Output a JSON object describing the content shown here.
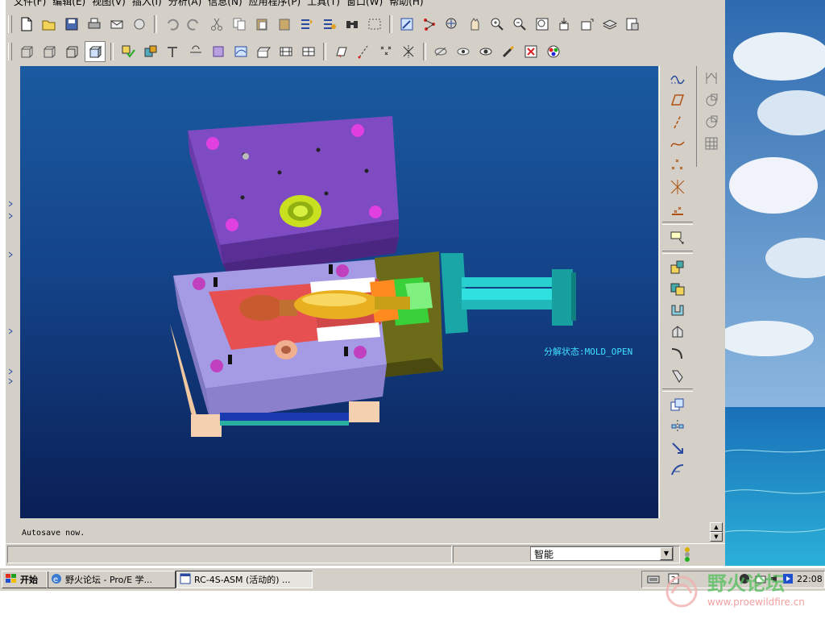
{
  "menu": [
    "文件(F)",
    "编辑(E)",
    "视图(V)",
    "插入(I)",
    "分析(A)",
    "信息(N)",
    "应用程序(P)",
    "工具(T)",
    "窗口(W)",
    "帮助(H)"
  ],
  "viewport": {
    "annotation": "分解状态:MOLD_OPEN"
  },
  "message": {
    "text": "Autosave now."
  },
  "status": {
    "filter_value": "智能"
  },
  "taskbar": {
    "start_label": "开始",
    "items": [
      {
        "label": "野火论坛 - Pro/E 学..."
      },
      {
        "label": "RC-4S-ASM (活动的) ..."
      }
    ],
    "clock": "22:08"
  },
  "watermark": {
    "name": "野火论坛",
    "url": "www.proewildfire.cn"
  },
  "colors": {
    "viewport_top": "#1a5aa0",
    "viewport_bottom": "#0a1f55",
    "window_face": "#d4d0c8",
    "desktop_sky": "#5a93c8",
    "desktop_sea": "#1e88c2"
  },
  "icons": {
    "toolbar1": [
      "new-file-icon",
      "open-folder-icon",
      "save-icon",
      "print-icon",
      "send-mail-icon",
      "mail-icon",
      "undo-icon",
      "redo-icon",
      "cut-icon",
      "copy-icon",
      "paste-icon",
      "paste-special-icon",
      "regenerate-icon",
      "regen-manager-icon",
      "find-icon",
      "select-box-icon",
      "sketch-icon",
      "relations-icon",
      "model-tree-icon",
      "spin-icon",
      "zoom-in-icon",
      "zoom-out-icon",
      "refit-icon",
      "orient-icon",
      "saved-views-icon",
      "layers-icon",
      "view-manager-icon"
    ],
    "toolbar2": [
      "wireframe-icon",
      "hidden-line-icon",
      "no-hidden-icon",
      "shading-icon",
      "mold-layout-icon",
      "mold-component-icon",
      "ejector-pin-icon",
      "waterline-icon",
      "parting-surface-icon",
      "skirt-surface-icon",
      "runner-icon",
      "volume-split-icon",
      "dimension-icon",
      "datum-plane-icon",
      "datum-axis-icon",
      "datum-point-icon",
      "csys-icon",
      "hide-icon",
      "show-icon",
      "mold-open-icon",
      "mold-check-icon",
      "close-window-icon",
      "color-icon"
    ],
    "right1": [
      "curve-icon",
      "plane-icon",
      "axis-icon",
      "sketched-curve-icon",
      "points-icon",
      "csys-icon",
      "analysis-icon",
      "note-icon",
      "component-icon",
      "insert-component-icon",
      "draft-icon",
      "shell-icon",
      "rib-icon",
      "round-icon",
      "copy-icon",
      "mirror-icon",
      "move-icon",
      "pattern-icon"
    ],
    "right2": [
      "split-icon",
      "sphere-icon",
      "sphere-outline-icon",
      "table-icon"
    ]
  }
}
